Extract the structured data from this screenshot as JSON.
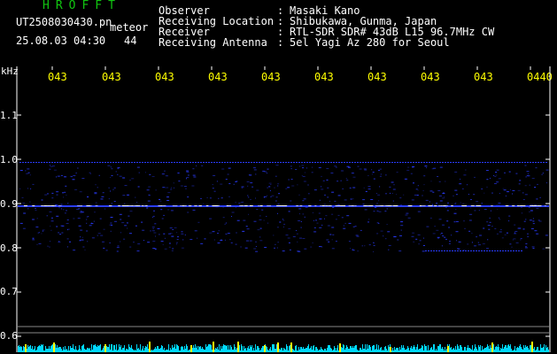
{
  "app": {
    "title": "HROFFT"
  },
  "file": {
    "name": "UT2508030430.pn",
    "type_label": "meteor"
  },
  "capture": {
    "datetime": "25.08.03 04:30",
    "count": "44"
  },
  "meta": [
    {
      "label": "Observer",
      "value": "Masaki Kano"
    },
    {
      "label": "Receiving Location",
      "value": "Shibukawa, Gunma, Japan"
    },
    {
      "label": "Receiver",
      "value": "RTL-SDR SDR# 43dB L15 96.7MHz CW"
    },
    {
      "label": "Receiving Antenna",
      "value": "5el Yagi Az 280 for Seoul"
    }
  ],
  "axis": {
    "y_unit": "kHz",
    "y_ticks": [
      "1.1",
      "1.0",
      "0.9",
      "0.8",
      "0.7",
      "0.6"
    ],
    "x_ticks": [
      "043",
      "043",
      "043",
      "043",
      "043",
      "043",
      "043",
      "043",
      "043",
      "0440"
    ]
  },
  "colors": {
    "background": "#000000",
    "trace": "#2a3cff",
    "carrier": "#ffffff",
    "baseline": "#00d8ff",
    "meteor_peak": "#ffff00",
    "app_title": "#11c611",
    "time_labels": "#ffff00"
  }
}
